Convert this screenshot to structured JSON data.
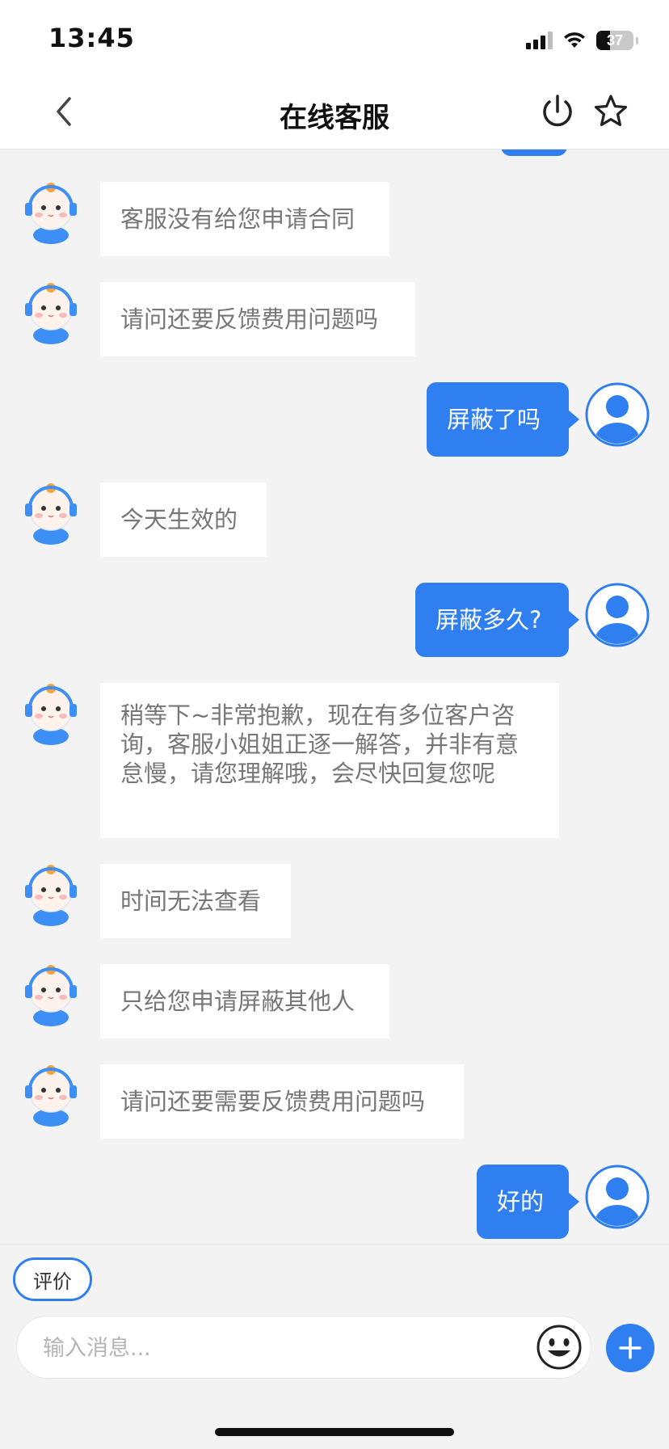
{
  "status_bar": {
    "time": "13:45",
    "battery": "37",
    "battery_level": 0.37
  },
  "nav": {
    "title": "在线客服"
  },
  "messages": [
    {
      "from": "agent",
      "text": "客服没有给您申请合同"
    },
    {
      "from": "agent",
      "text": "请问还要反馈费用问题吗"
    },
    {
      "from": "user",
      "text": "屏蔽了吗"
    },
    {
      "from": "agent",
      "text": "今天生效的"
    },
    {
      "from": "user",
      "text": "屏蔽多久?"
    },
    {
      "from": "agent",
      "text": "稍等下~非常抱歉，现在有多位客户咨询，客服小姐姐正逐一解答，并非有意怠慢，请您理解哦，会尽快回复您呢"
    },
    {
      "from": "agent",
      "text": "时间无法查看"
    },
    {
      "from": "agent",
      "text": "只给您申请屏蔽其他人"
    },
    {
      "from": "agent",
      "text": "请问还要需要反馈费用问题吗"
    },
    {
      "from": "user",
      "text": "好的"
    }
  ],
  "bottom": {
    "rate_label": "评价",
    "input_placeholder": "输入消息..."
  },
  "icons": {
    "back": "chevron-left-icon",
    "power": "power-icon",
    "star": "star-icon",
    "emoji": "smiley-icon",
    "plus": "plus-icon",
    "agent_avatar": "customer-service-avatar",
    "user_avatar": "user-avatar"
  },
  "colors": {
    "accent": "#2f7ff0",
    "background": "#f3f3f3",
    "bubble_agent": "#ffffff"
  }
}
